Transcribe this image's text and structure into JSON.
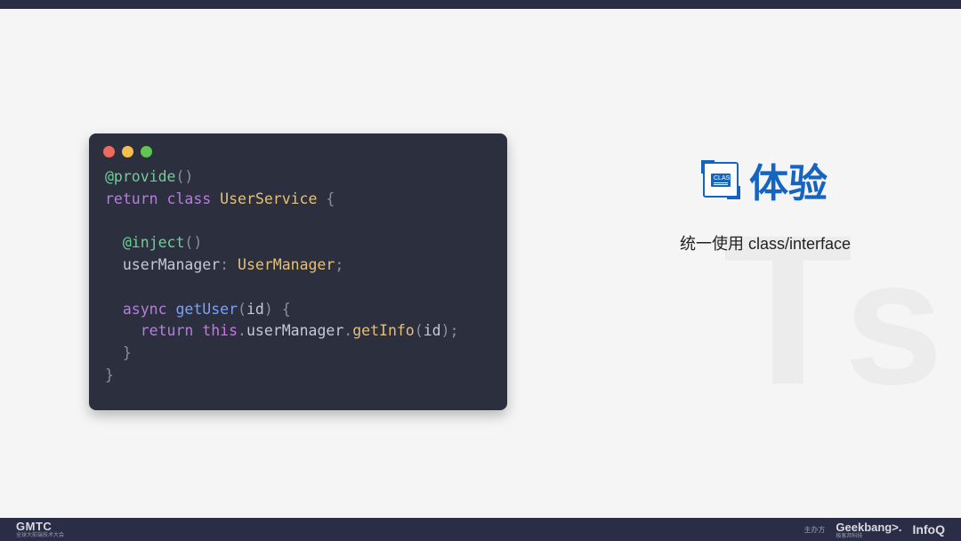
{
  "icon_label": "CLASS",
  "heading": "体验",
  "subtitle": "统一使用 class/interface",
  "watermark": {
    "t": "T",
    "s": "s"
  },
  "code": {
    "decorator1": "@provide",
    "kw_return": "return",
    "kw_class": "class",
    "classname": "UserService",
    "decorator2": "@inject",
    "prop_name": "userManager",
    "prop_type": "UserManager",
    "kw_async": "async",
    "method": "getUser",
    "param": "id",
    "kw_return2": "return",
    "this": "this",
    "member": "userManager",
    "call": "getInfo",
    "arg": "id"
  },
  "footer": {
    "left_big": "GMTC",
    "left_small": "全球大前端技术大会",
    "host_label": "主办方",
    "brand1": "Geekbang>.",
    "brand1_sub": "极客邦科技",
    "brand2": "InfoQ"
  }
}
